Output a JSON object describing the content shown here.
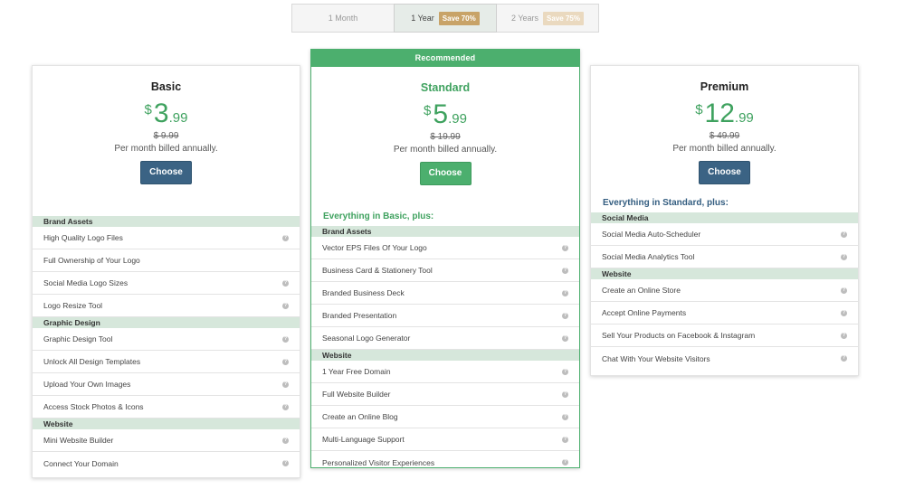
{
  "billing": {
    "options": [
      {
        "label": "1 Month",
        "save": ""
      },
      {
        "label": "1 Year",
        "save": "Save 70%"
      },
      {
        "label": "2 Years",
        "save": "Save 75%"
      }
    ]
  },
  "plans": [
    {
      "name": "Basic",
      "currency": "$",
      "price_int": "3",
      "price_dec": ".99",
      "old_price": "$ 9.99",
      "billed": "Per month billed annually.",
      "button": "Choose",
      "intro": "",
      "sections": [
        {
          "title": "Brand Assets",
          "items": [
            {
              "label": "High Quality Logo Files",
              "info": true
            },
            {
              "label": "Full Ownership of Your Logo",
              "info": false
            },
            {
              "label": "Social Media Logo Sizes",
              "info": true
            },
            {
              "label": "Logo Resize Tool",
              "info": true
            }
          ]
        },
        {
          "title": "Graphic Design",
          "items": [
            {
              "label": "Graphic Design Tool",
              "info": true
            },
            {
              "label": "Unlock All Design Templates",
              "info": true
            },
            {
              "label": "Upload Your Own Images",
              "info": true
            },
            {
              "label": "Access Stock Photos & Icons",
              "info": true
            }
          ]
        },
        {
          "title": "Website",
          "items": [
            {
              "label": "Mini Website Builder",
              "info": true
            },
            {
              "label": "Connect Your Domain",
              "info": true
            }
          ]
        }
      ]
    },
    {
      "ribbon": "Recommended",
      "name": "Standard",
      "currency": "$",
      "price_int": "5",
      "price_dec": ".99",
      "old_price": "$ 19.99",
      "billed": "Per month billed annually.",
      "button": "Choose",
      "intro": "Everything in Basic, plus:",
      "sections": [
        {
          "title": "Brand Assets",
          "items": [
            {
              "label": "Vector EPS Files Of Your Logo",
              "info": true
            },
            {
              "label": "Business Card & Stationery Tool",
              "info": true
            },
            {
              "label": "Branded Business Deck",
              "info": true
            },
            {
              "label": "Branded Presentation",
              "info": true
            },
            {
              "label": "Seasonal Logo Generator",
              "info": true
            }
          ]
        },
        {
          "title": "Website",
          "items": [
            {
              "label": "1 Year Free Domain",
              "info": true
            },
            {
              "label": "Full Website Builder",
              "info": true
            },
            {
              "label": "Create an Online Blog",
              "info": true
            },
            {
              "label": "Multi-Language Support",
              "info": true
            },
            {
              "label": "Personalized Visitor Experiences",
              "info": true
            }
          ]
        }
      ]
    },
    {
      "name": "Premium",
      "currency": "$",
      "price_int": "12",
      "price_dec": ".99",
      "old_price": "$ 49.99",
      "billed": "Per month billed annually.",
      "button": "Choose",
      "intro": "Everything in Standard, plus:",
      "sections": [
        {
          "title": "Social Media",
          "items": [
            {
              "label": "Social Media Auto-Scheduler",
              "info": true
            },
            {
              "label": "Social Media Analytics Tool",
              "info": true
            }
          ]
        },
        {
          "title": "Website",
          "items": [
            {
              "label": "Create an Online Store",
              "info": true
            },
            {
              "label": "Accept Online Payments",
              "info": true
            },
            {
              "label": "Sell Your Products on Facebook & Instagram",
              "info": true
            },
            {
              "label": "Chat With Your Website Visitors",
              "info": true
            }
          ]
        }
      ]
    }
  ],
  "colors": {
    "accent_green": "#4caf6e",
    "brand_blue": "#3b6384",
    "section_bg": "#d6e7db",
    "save_gold": "#c8a368"
  },
  "icons": {
    "info": "info-icon"
  }
}
